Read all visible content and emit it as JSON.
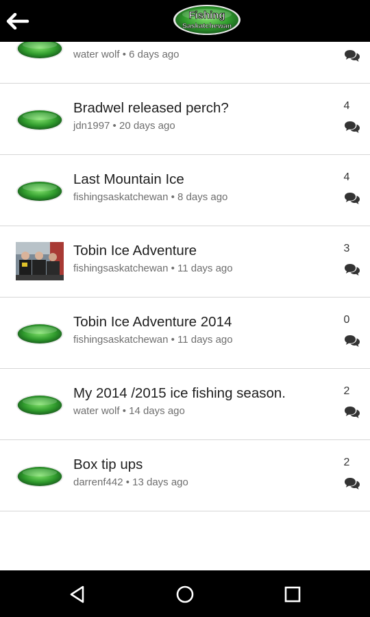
{
  "app": {
    "logo_line1": "Fishing",
    "logo_line2": "Saskatchewan",
    "colors": {
      "bar": "#000000",
      "logo_green": "#3fa535",
      "divider": "#d6d6d6",
      "meta": "#6e6e6e",
      "title": "#1e1e1e"
    }
  },
  "partial_row": {
    "meta": "water wolf • 6 days ago",
    "icon": "comments-icon"
  },
  "topics": [
    {
      "title": "Bradwel released perch?",
      "meta": "jdn1997 • 20 days ago",
      "count": "4",
      "avatar": "logo"
    },
    {
      "title": "Last Mountain Ice",
      "meta": "fishingsaskatchewan • 8 days ago",
      "count": "4",
      "avatar": "logo"
    },
    {
      "title": "Tobin Ice Adventure",
      "meta": "fishingsaskatchewan • 11 days ago",
      "count": "3",
      "avatar": "photo"
    },
    {
      "title": "Tobin Ice Adventure 2014",
      "meta": "fishingsaskatchewan • 11 days ago",
      "count": "0",
      "avatar": "logo"
    },
    {
      "title": "My 2014 /2015 ice fishing season.",
      "meta": "water wolf • 14 days ago",
      "count": "2",
      "avatar": "logo"
    },
    {
      "title": "Box tip ups",
      "meta": "darrenf442 • 13 days ago",
      "count": "2",
      "avatar": "logo"
    }
  ],
  "navbar": {
    "icons": [
      "back-triangle-icon",
      "home-circle-icon",
      "recents-square-icon"
    ]
  }
}
